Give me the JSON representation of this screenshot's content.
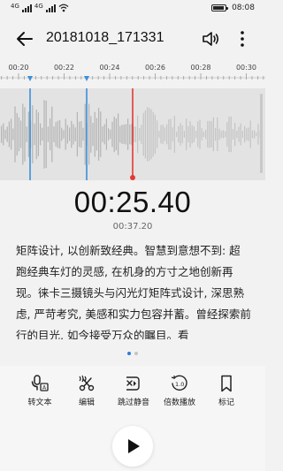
{
  "status_bar": {
    "signal_1_label": "4G",
    "signal_2_label": "4G",
    "time": "08:08"
  },
  "header": {
    "title": "20181018_171331",
    "icons": [
      "back-arrow-icon",
      "speaker-icon",
      "more-vertical-icon"
    ]
  },
  "timeline": {
    "ticks": [
      "00:20",
      "00:22",
      "00:24",
      "00:26",
      "00:28",
      "00:30"
    ],
    "marker_color": "#3b8fd9",
    "playhead_color": "#e53935"
  },
  "player": {
    "current_time": "00:25.40",
    "total_time": "00:37.20"
  },
  "transcript": {
    "text": "矩阵设计, 以创新致经典。智慧到意想不到: 超跑经典车灯的灵感, 在机身的方寸之地创新再现。徕卡三摄镜头与闪光灯矩阵式设计, 深思熟虑, 严苛考究, 美感和实力包容并蓄。曾经探索前行的目光, 如今接受万众的瞩目。看"
  },
  "pager": {
    "pages": 2,
    "current": 1
  },
  "actions": [
    {
      "label": "转文本",
      "icon": "speech-to-text-icon"
    },
    {
      "label": "编辑",
      "icon": "scissors-edit-icon"
    },
    {
      "label": "跳过静音",
      "icon": "mute-skip-icon"
    },
    {
      "label": "倍数播放",
      "icon": "playback-speed-icon"
    },
    {
      "label": "标记",
      "icon": "bookmark-icon"
    }
  ],
  "playback": {
    "state": "paused",
    "icon": "play-icon"
  },
  "colors": {
    "accent": "#3b8fd9",
    "playhead": "#e53935",
    "waveform": "#b8b8b8"
  }
}
